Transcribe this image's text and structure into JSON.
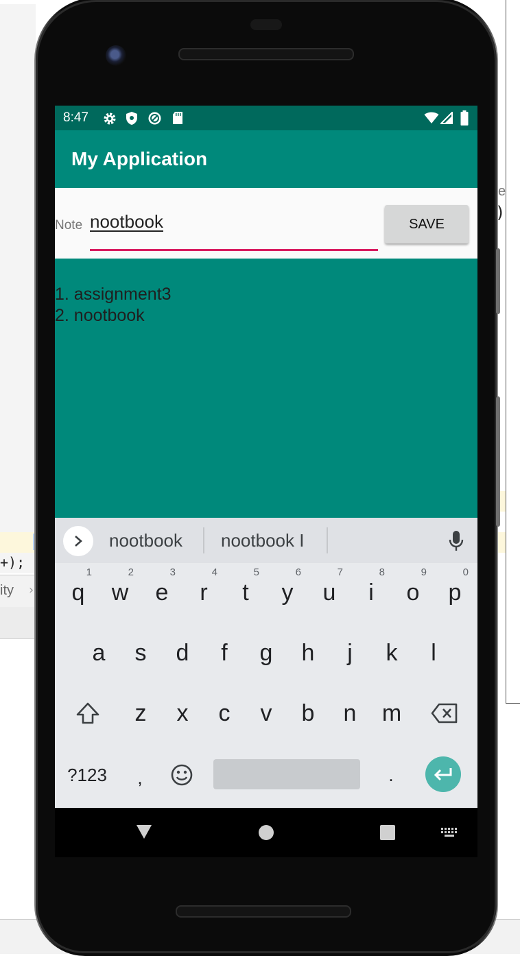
{
  "status_bar": {
    "time": "8:47",
    "left_icons": [
      "gear-icon",
      "shield-icon",
      "sync-icon",
      "sd-card-icon"
    ],
    "right_icons": [
      "wifi-icon",
      "signal-icon",
      "battery-icon"
    ]
  },
  "app": {
    "title": "My Application"
  },
  "note_form": {
    "label": "Note",
    "value": "nootbook",
    "save_label": "SAVE"
  },
  "notes": [
    {
      "text": "1. assignment3"
    },
    {
      "text": "2. nootbook"
    }
  ],
  "keyboard": {
    "suggestions": [
      "nootbook",
      "nootbook I"
    ],
    "row1": [
      {
        "key": "q",
        "hint": "1"
      },
      {
        "key": "w",
        "hint": "2"
      },
      {
        "key": "e",
        "hint": "3"
      },
      {
        "key": "r",
        "hint": "4"
      },
      {
        "key": "t",
        "hint": "5"
      },
      {
        "key": "y",
        "hint": "6"
      },
      {
        "key": "u",
        "hint": "7"
      },
      {
        "key": "i",
        "hint": "8"
      },
      {
        "key": "o",
        "hint": "9"
      },
      {
        "key": "p",
        "hint": "0"
      }
    ],
    "row2": [
      "a",
      "s",
      "d",
      "f",
      "g",
      "h",
      "j",
      "k",
      "l"
    ],
    "row3": [
      "z",
      "x",
      "c",
      "v",
      "b",
      "n",
      "m"
    ],
    "bottom": {
      "symbols_label": "?123",
      "comma": ",",
      "period": "."
    }
  },
  "ide_fragments": {
    "code_tail": "+);",
    "breadcrumb_tail": "ity",
    "right_text_1": "e",
    "right_text_2": ")"
  },
  "colors": {
    "status_bar": "#00695c",
    "primary": "#00897b",
    "accent": "#d81b60",
    "enter_key": "#4db6ac"
  }
}
